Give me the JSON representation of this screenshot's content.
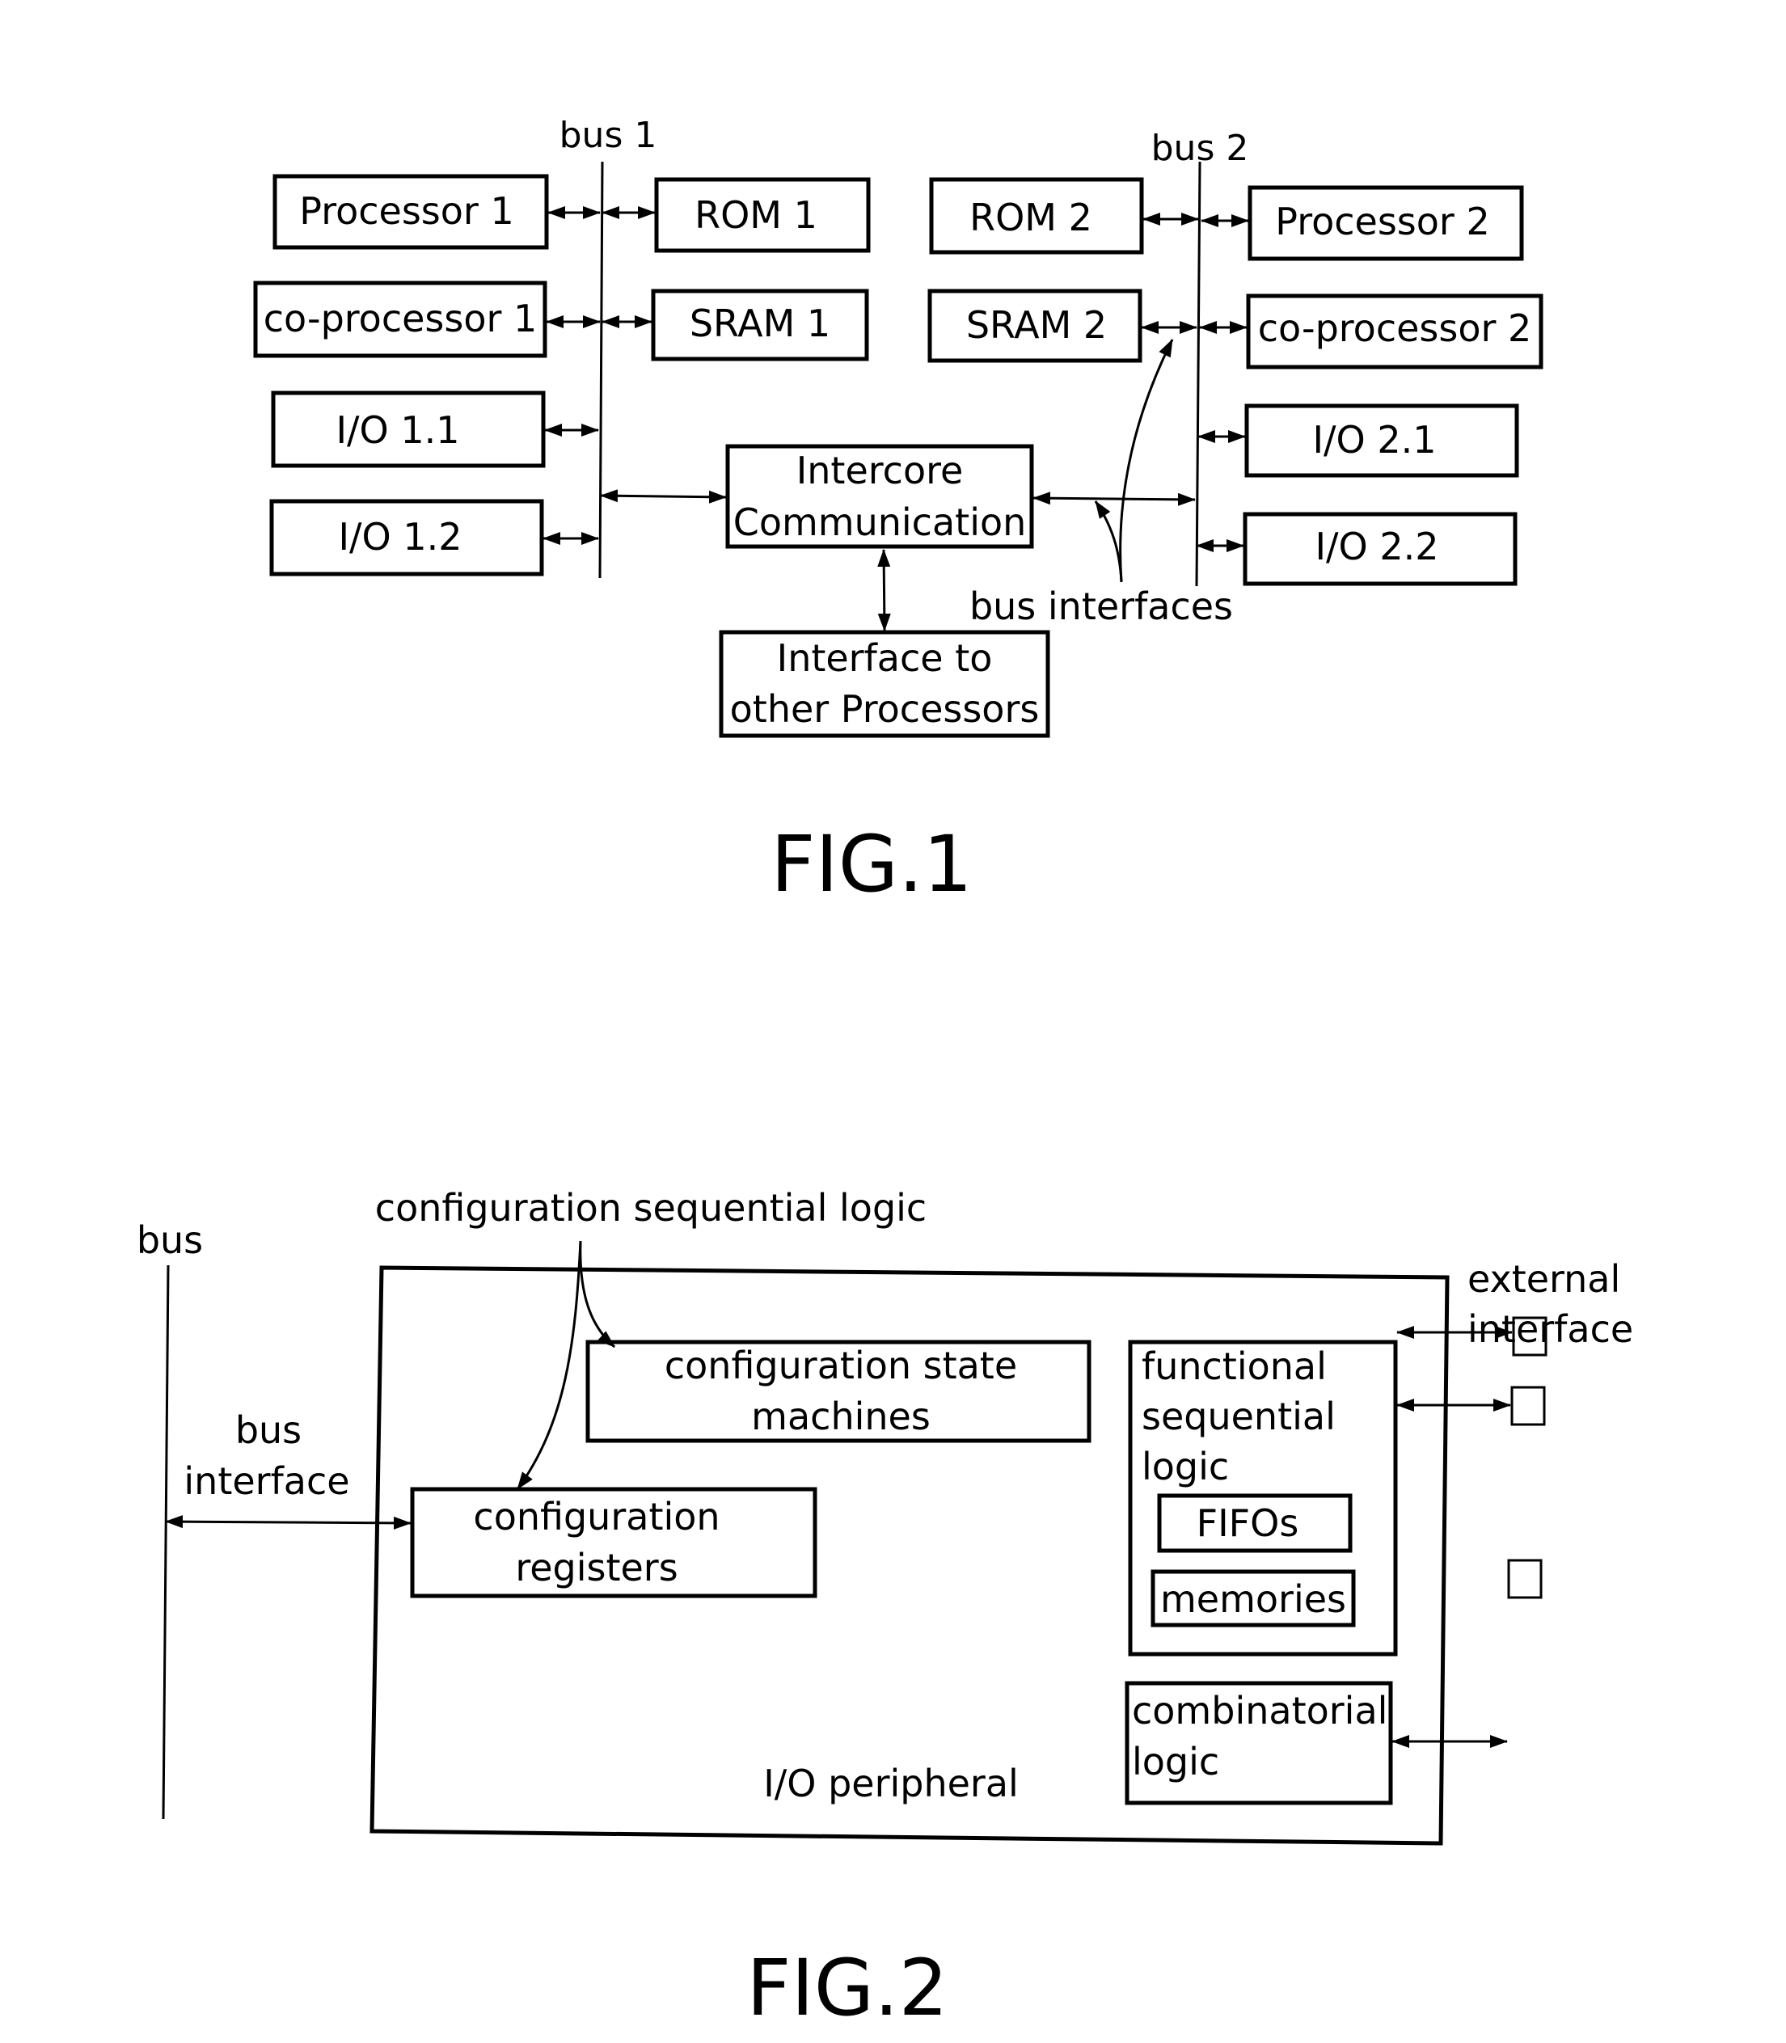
{
  "fig1": {
    "caption": "FIG.1",
    "bus1_label": "bus 1",
    "bus2_label": "bus 2",
    "bus_interfaces_label": "bus interfaces",
    "left_blocks": [
      "Processor 1",
      "co-processor 1",
      "I/O 1.1",
      "I/O 1.2"
    ],
    "bus1_right_blocks": [
      "ROM 1",
      "SRAM 1"
    ],
    "bus2_left_blocks": [
      "ROM 2",
      "SRAM 2"
    ],
    "right_blocks": [
      "Processor 2",
      "co-processor 2",
      "I/O 2.1",
      "I/O 2.2"
    ],
    "intercore": [
      "Intercore",
      "Communication"
    ],
    "interface_other": [
      "Interface to",
      "other Processors"
    ]
  },
  "fig2": {
    "caption": "FIG.2",
    "bus_label": "bus",
    "bus_interface_label": [
      "bus",
      "interface"
    ],
    "config_seq_logic_label": "configuration sequential logic",
    "config_state_machines": [
      "configuration state",
      "machines"
    ],
    "config_registers": [
      "configuration",
      "registers"
    ],
    "functional_seq_logic": [
      "functional",
      "sequential",
      "logic"
    ],
    "fifos": "FIFOs",
    "memories": "memories",
    "combinatorial_logic": [
      "combinatorial",
      "logic"
    ],
    "io_peripheral": "I/O peripheral",
    "external_interface": [
      "external",
      "interface"
    ]
  }
}
